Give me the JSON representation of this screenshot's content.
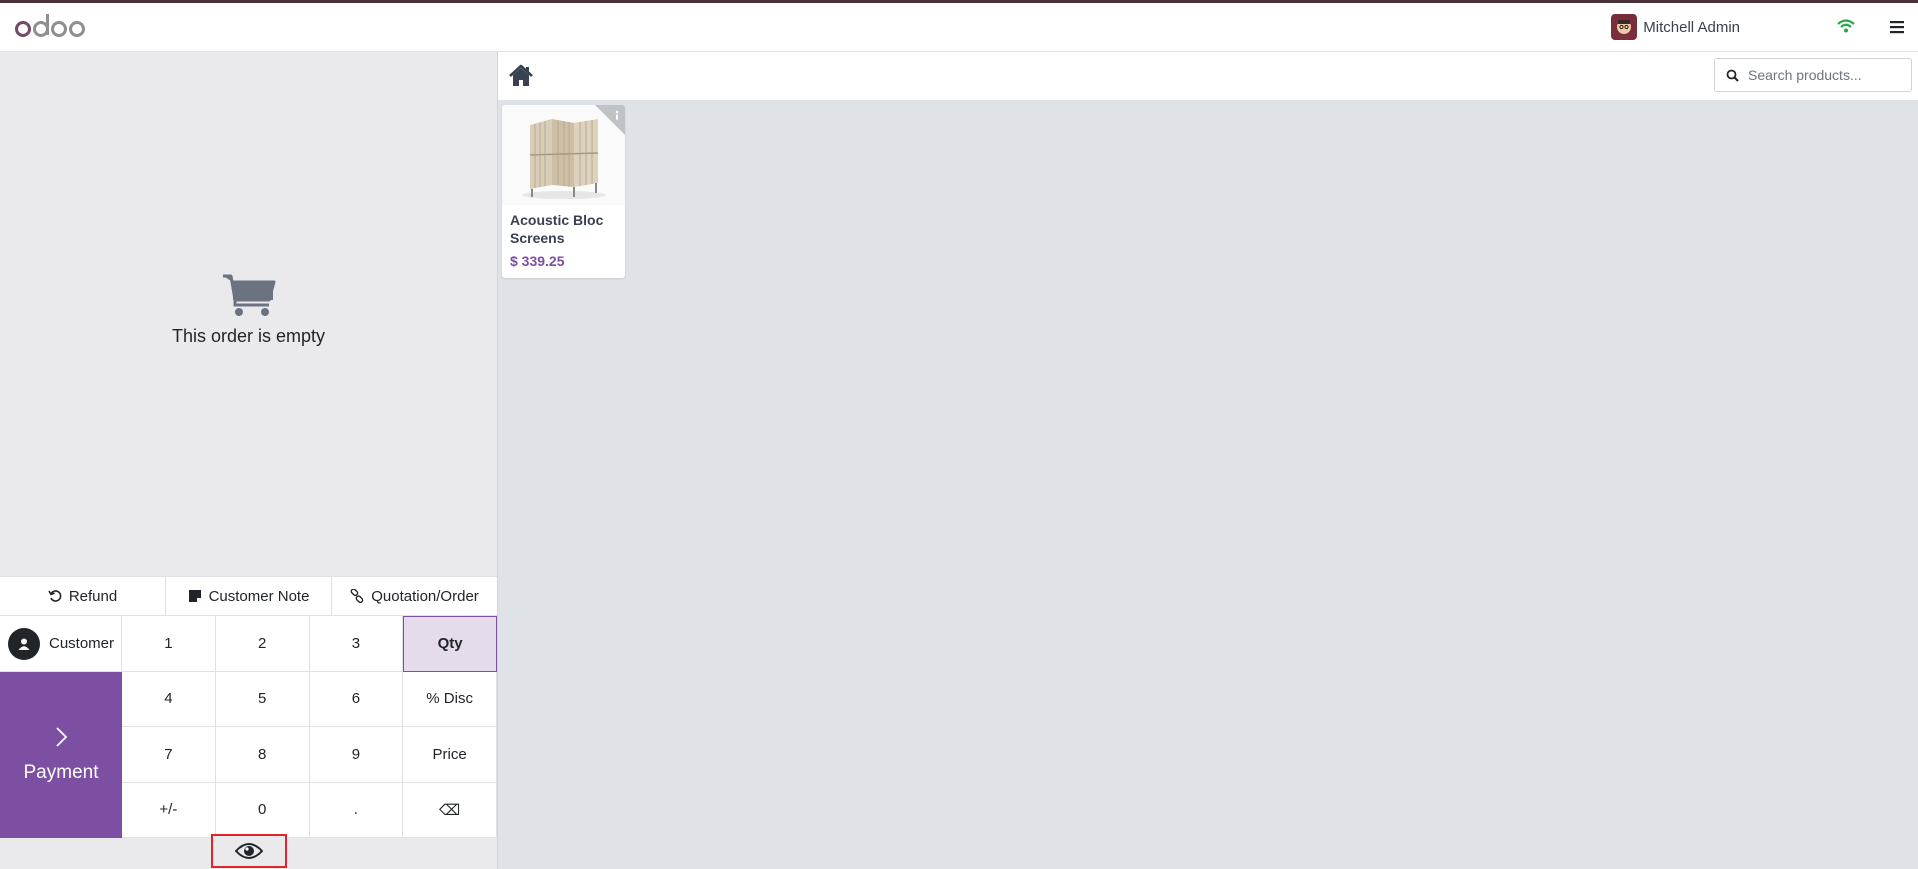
{
  "navbar": {
    "logo_text": "odoo",
    "user_name": "Mitchell Admin"
  },
  "order": {
    "empty_text": "This order is empty"
  },
  "actions": {
    "refund": "Refund",
    "customer_note": "Customer Note",
    "quotation": "Quotation/Order"
  },
  "pad": {
    "customer": "Customer",
    "payment": "Payment",
    "keys": [
      "1",
      "2",
      "3",
      "Qty",
      "4",
      "5",
      "6",
      "% Disc",
      "7",
      "8",
      "9",
      "Price",
      "+/-",
      "0",
      ".",
      "⌫"
    ],
    "active_key": "Qty"
  },
  "search": {
    "placeholder": "Search products..."
  },
  "products": [
    {
      "name": "Acoustic Bloc Screens",
      "price": "$ 339.25"
    }
  ],
  "colors": {
    "brand": "#7c4fa3",
    "strip": "#4a3239",
    "wifi": "#28a745",
    "highlight": "#e0242b"
  }
}
